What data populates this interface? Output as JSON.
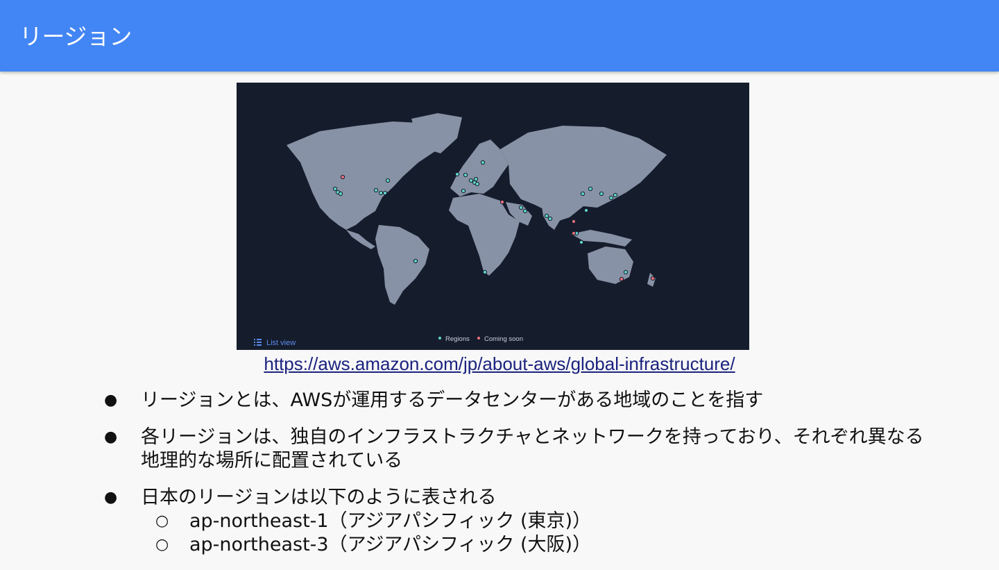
{
  "header": {
    "title": "リージョン"
  },
  "map": {
    "list_view_label": "List view",
    "legend": {
      "regions": "Regions",
      "coming_soon": "Coming soon"
    },
    "colors": {
      "background": "#151c2b",
      "land": "#8892a6",
      "region": "#5fd3c8",
      "coming_soon": "#e8707e",
      "link": "#5b8def"
    }
  },
  "source_url": "https://aws.amazon.com/jp/about-aws/global-infrastructure/",
  "bullets": [
    {
      "text": "リージョンとは、AWSが運用するデータセンターがある地域のことを指す"
    },
    {
      "text": "各リージョンは、独自のインフラストラクチャとネットワークを持っており、それぞれ異なる地理的な場所に配置されている"
    },
    {
      "text": "日本のリージョンは以下のように表される",
      "sub": [
        "ap-northeast-1（アジアパシフィック (東京)）",
        "ap-northeast-3（アジアパシフィック (大阪)）"
      ]
    }
  ]
}
